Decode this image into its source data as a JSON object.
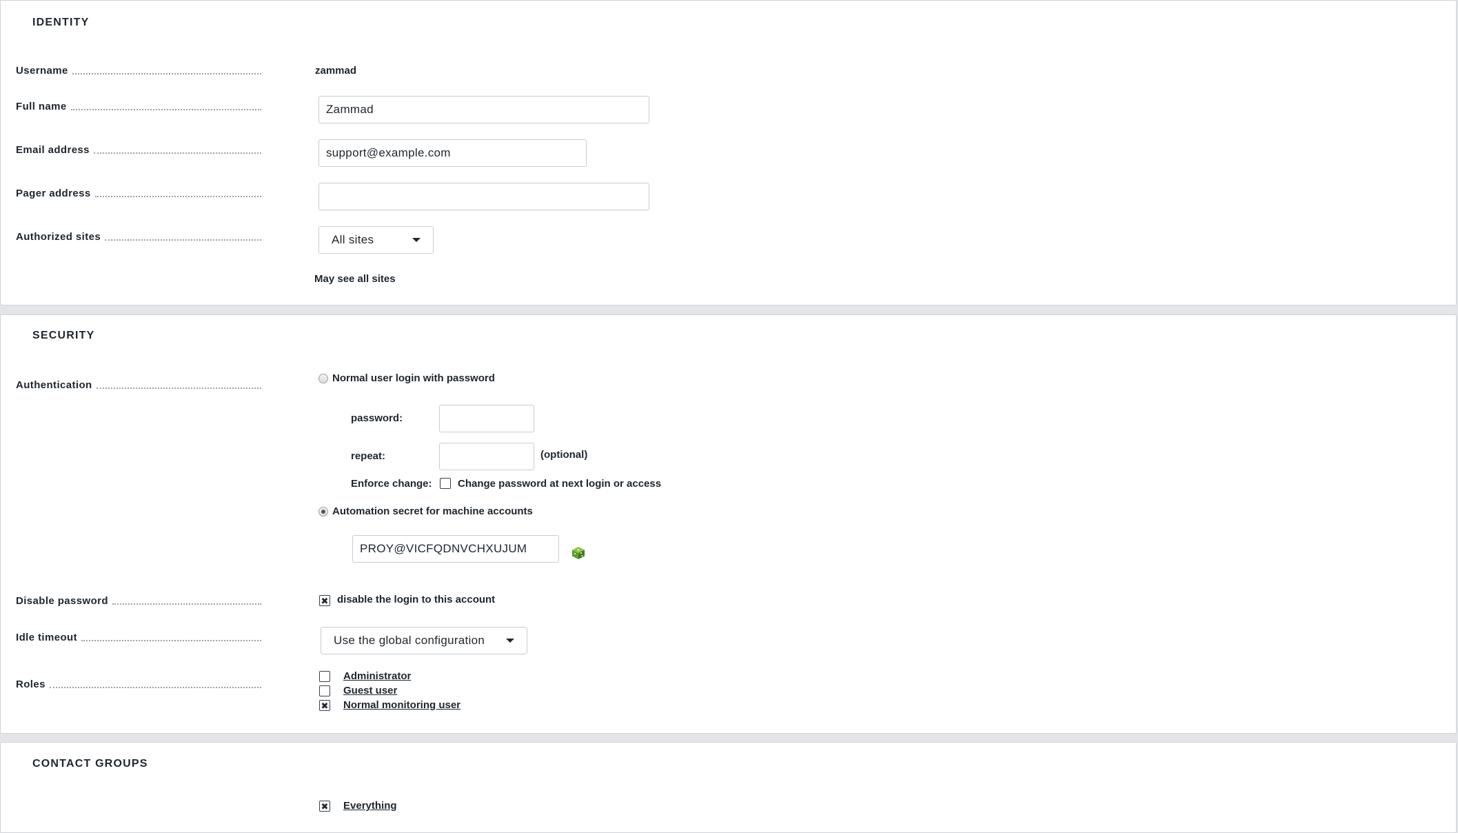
{
  "identity": {
    "title": "IDENTITY",
    "username_label": "Username",
    "username_value": "zammad",
    "fullname_label": "Full name",
    "fullname_value": "Zammad",
    "email_label": "Email address",
    "email_value": "support@example.com",
    "pager_label": "Pager address",
    "pager_value": "",
    "sites_label": "Authorized sites",
    "sites_value": "All sites",
    "sites_note": "May see all sites"
  },
  "security": {
    "title": "SECURITY",
    "auth_label": "Authentication",
    "option_password": "Normal user login with password",
    "password_label": "password:",
    "repeat_label": "repeat:",
    "optional_text": "(optional)",
    "enforce_label": "Enforce change:",
    "enforce_text": "Change password at next login or access",
    "option_automation": "Automation secret for machine accounts",
    "automation_secret": "PROY@VICFQDNVCHXUJUM",
    "disable_label": "Disable password",
    "disable_text": "disable the login to this account",
    "idle_label": "Idle timeout",
    "idle_value": "Use the global configuration",
    "roles_label": "Roles",
    "roles": [
      {
        "label": "Administrator",
        "checked": false
      },
      {
        "label": "Guest user",
        "checked": false
      },
      {
        "label": "Normal monitoring user",
        "checked": true
      }
    ]
  },
  "contact_groups": {
    "title": "CONTACT GROUPS",
    "items": [
      {
        "label": "Everything",
        "checked": true
      }
    ]
  },
  "colors": {
    "background": "#e3e5e8",
    "panel": "#ffffff",
    "text": "#1e262e",
    "dice_icon": "#5aa02c"
  }
}
